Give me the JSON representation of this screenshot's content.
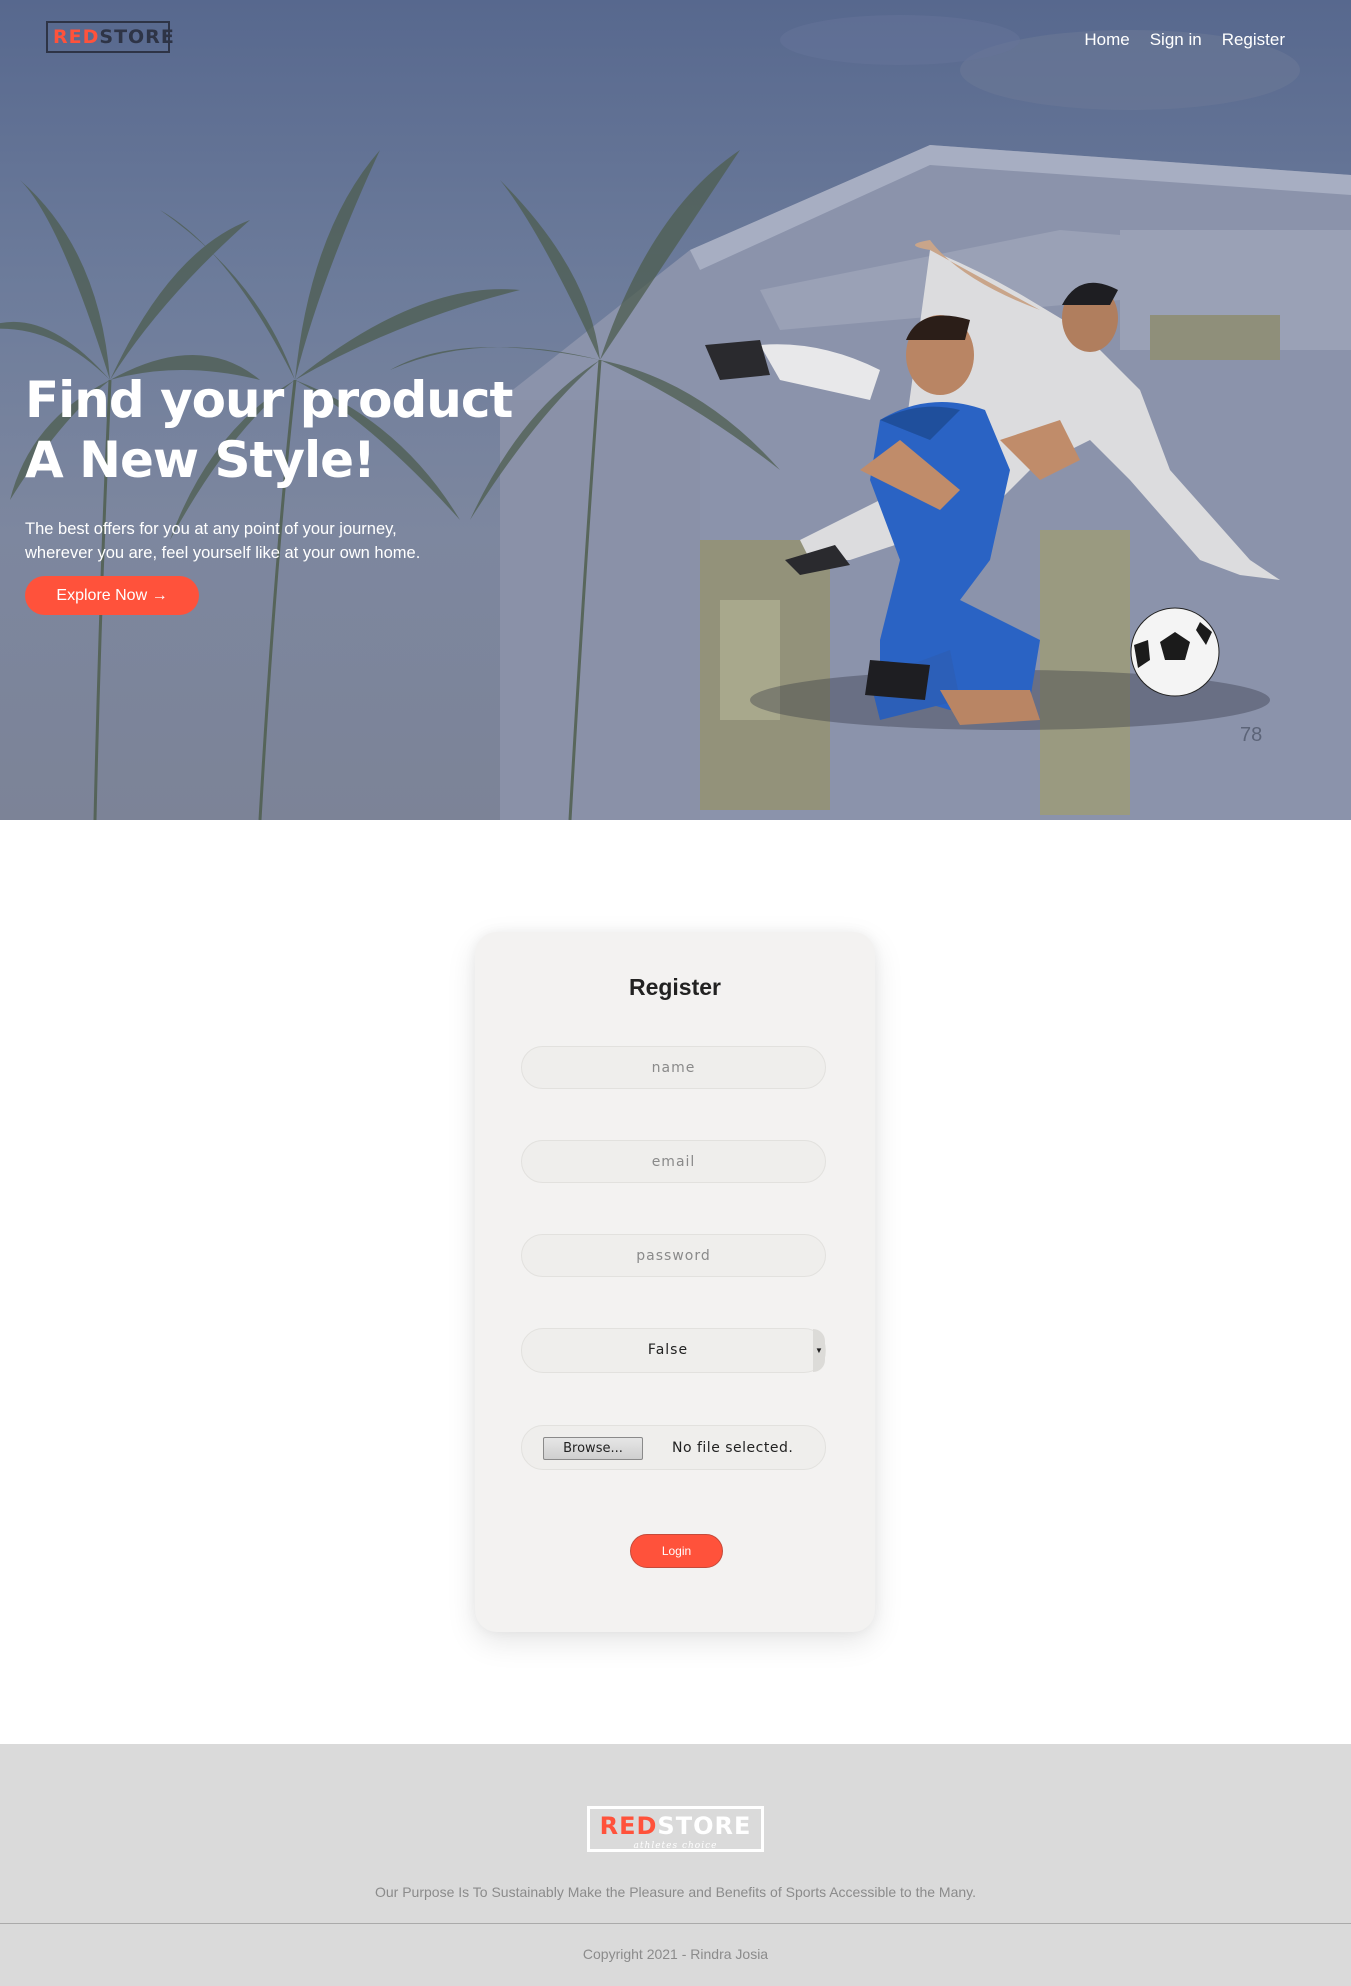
{
  "header": {
    "logo_red": "RED",
    "logo_dark": "STORE",
    "nav": [
      {
        "label": "Home"
      },
      {
        "label": "Sign in"
      },
      {
        "label": "Register"
      }
    ]
  },
  "hero": {
    "title_line1": "Find your product",
    "title_line2": "A New Style!",
    "desc_line1": "The best offers for you at any point of your journey,",
    "desc_line2": "wherever you are, feel yourself like at your own home.",
    "cta_label": "Explore Now →",
    "watermark": "78"
  },
  "register": {
    "title": "Register",
    "name_placeholder": "name",
    "email_placeholder": "email",
    "password_placeholder": "password",
    "select_value": "False",
    "browse_label": "Browse...",
    "file_status": "No file selected.",
    "submit_label": "Login"
  },
  "footer": {
    "logo_red": "RED",
    "logo_white": "STORE",
    "logo_tagline": "athletes choice",
    "purpose": "Our Purpose Is To Sustainably Make the Pleasure and Benefits of Sports Accessible to the Many.",
    "copyright": "Copyright 2021 - Rindra Josia"
  },
  "colors": {
    "accent": "#ff523b",
    "hero_overlay": "#5d6d92",
    "card_bg": "#f3f2f1",
    "footer_bg": "#dadada"
  }
}
